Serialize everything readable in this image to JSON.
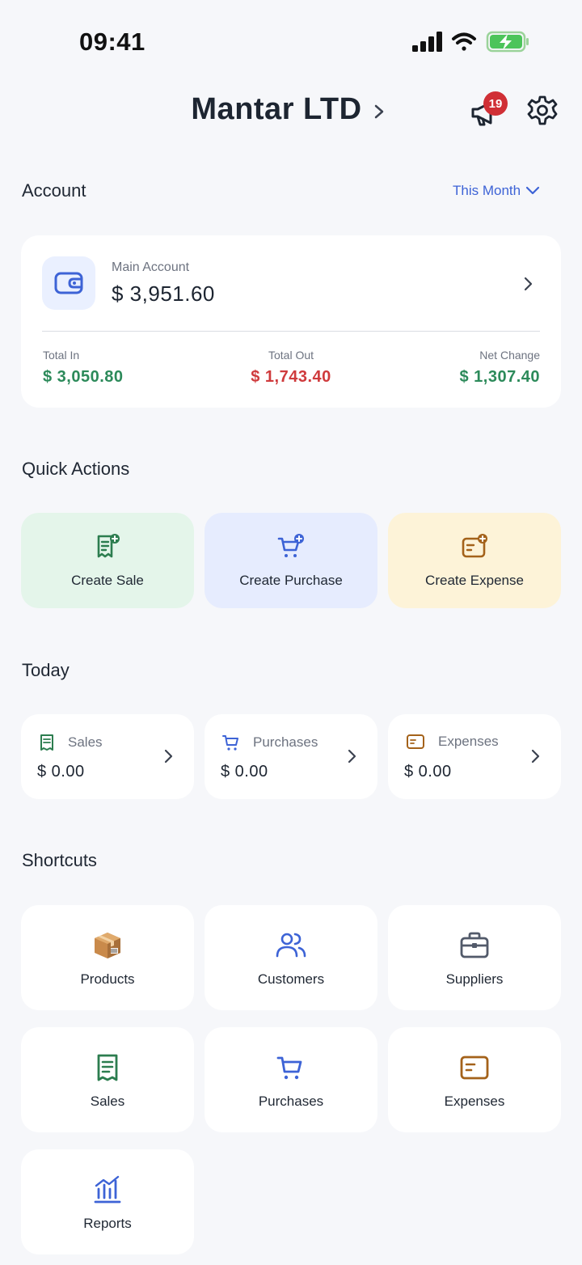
{
  "status_bar": {
    "time": "09:41"
  },
  "header": {
    "company_name": "Mantar LTD",
    "notification_count": "19"
  },
  "account_section": {
    "title": "Account",
    "period_selector": "This Month",
    "main_account": {
      "label": "Main Account",
      "balance": "$ 3,951.60",
      "total_in_label": "Total In",
      "total_in": "$ 3,050.80",
      "total_out_label": "Total Out",
      "total_out": "$ 1,743.40",
      "net_change_label": "Net Change",
      "net_change": "$ 1,307.40"
    }
  },
  "quick_actions": {
    "title": "Quick Actions",
    "items": [
      {
        "label": "Create Sale",
        "icon": "receipt-plus-icon"
      },
      {
        "label": "Create Purchase",
        "icon": "cart-plus-icon"
      },
      {
        "label": "Create Expense",
        "icon": "wallet-card-plus-icon"
      }
    ]
  },
  "today": {
    "title": "Today",
    "items": [
      {
        "label": "Sales",
        "value": "$ 0.00",
        "icon": "receipt-icon"
      },
      {
        "label": "Purchases",
        "value": "$ 0.00",
        "icon": "cart-icon"
      },
      {
        "label": "Expenses",
        "value": "$ 0.00",
        "icon": "card-icon"
      }
    ]
  },
  "shortcuts": {
    "title": "Shortcuts",
    "items": [
      {
        "label": "Products",
        "icon": "package-icon"
      },
      {
        "label": "Customers",
        "icon": "users-icon"
      },
      {
        "label": "Suppliers",
        "icon": "briefcase-icon"
      },
      {
        "label": "Sales",
        "icon": "receipt-icon"
      },
      {
        "label": "Purchases",
        "icon": "cart-icon"
      },
      {
        "label": "Expenses",
        "icon": "card-icon"
      },
      {
        "label": "Reports",
        "icon": "bar-chart-icon"
      }
    ]
  },
  "colors": {
    "accent_blue": "#3d63d6",
    "positive_green": "#2c8a5a",
    "negative_red": "#cf3a3c",
    "expense_brown": "#a4621a",
    "badge_red": "#d02f35"
  }
}
